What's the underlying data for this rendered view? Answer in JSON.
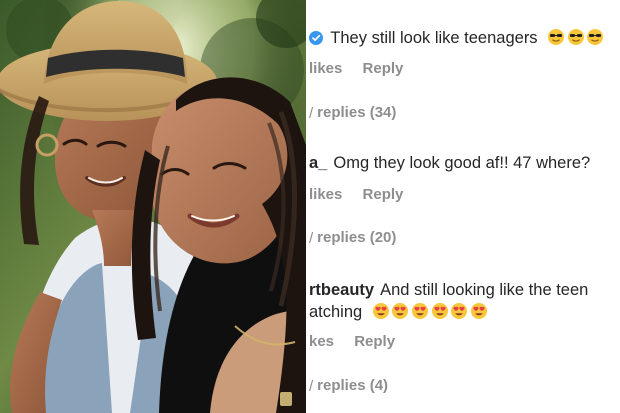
{
  "photo": {
    "description_icon": "selfie-photo"
  },
  "comments": [
    {
      "username": "",
      "verified": true,
      "text": "They still look like teenagers",
      "emoji": [
        "sunglasses-emoji",
        "sunglasses-emoji",
        "sunglasses-emoji"
      ],
      "likes_label": "likes",
      "reply_label": "Reply",
      "view_replies_label": "replies (34)"
    },
    {
      "username": "a_",
      "verified": false,
      "text": "Omg they look good af!! 47 where?",
      "emoji": [],
      "likes_label": "likes",
      "reply_label": "Reply",
      "view_replies_label": "replies (20)"
    },
    {
      "username": "rtbeauty",
      "verified": false,
      "text": "And still looking like the teen",
      "text_line2": "atching",
      "emoji": [
        "heart-eyes-emoji",
        "heart-eyes-emoji",
        "heart-eyes-emoji",
        "heart-eyes-emoji",
        "heart-eyes-emoji",
        "heart-eyes-emoji"
      ],
      "likes_label": "kes",
      "reply_label": "Reply",
      "view_replies_label": "replies (4)"
    }
  ],
  "colors": {
    "text": "#262626",
    "muted": "#8e8e8e",
    "verified": "#3897f0"
  }
}
